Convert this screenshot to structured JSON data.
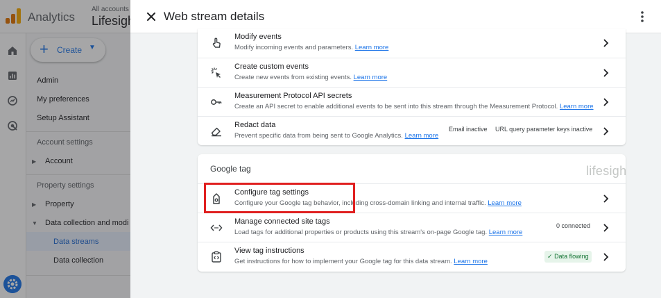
{
  "app": {
    "name": "Analytics",
    "account_label": "All accounts",
    "account_name": "Lifesight",
    "create_label": "Create"
  },
  "sidenav": {
    "admin": "Admin",
    "my_preferences": "My preferences",
    "setup_assistant": "Setup Assistant",
    "account_settings": "Account settings",
    "account": "Account",
    "property_settings": "Property settings",
    "property": "Property",
    "data_collection_and_modification": "Data collection and modi",
    "data_streams": "Data streams",
    "data_collection": "Data collection"
  },
  "panel": {
    "title": "Web stream details",
    "learn_more": "Learn more",
    "events_rows": [
      {
        "title": "Modify events",
        "desc": "Modify incoming events and parameters.",
        "icon": "touch-icon"
      },
      {
        "title": "Create custom events",
        "desc": "Create new events from existing events.",
        "icon": "sparkle-cursor-icon"
      },
      {
        "title": "Measurement Protocol API secrets",
        "desc": "Create an API secret to enable additional events to be sent into this stream through the Measurement Protocol.",
        "icon": "key-icon"
      },
      {
        "title": "Redact data",
        "desc": "Prevent specific data from being sent to Google Analytics.",
        "icon": "eraser-icon",
        "chip1": "Email inactive",
        "chip2": "URL query parameter keys inactive"
      }
    ],
    "google_tag_heading": "Google tag",
    "watermark": "lifesight",
    "tag_rows": [
      {
        "title": "Configure tag settings",
        "desc": "Configure your Google tag behavior, including cross-domain linking and internal traffic.",
        "icon": "tag-icon"
      },
      {
        "title": "Manage connected site tags",
        "desc": "Load tags for additional properties or products using this stream's on-page Google tag.",
        "icon": "code-arrows-icon",
        "chip": "0 connected"
      },
      {
        "title": "View tag instructions",
        "desc": "Get instructions for how to implement your Google tag for this data stream.",
        "icon": "clipboard-code-icon",
        "chip": "Data flowing"
      }
    ]
  },
  "colors": {
    "accent": "#1a73e8",
    "highlight": "#e02020",
    "success": "#137333"
  }
}
